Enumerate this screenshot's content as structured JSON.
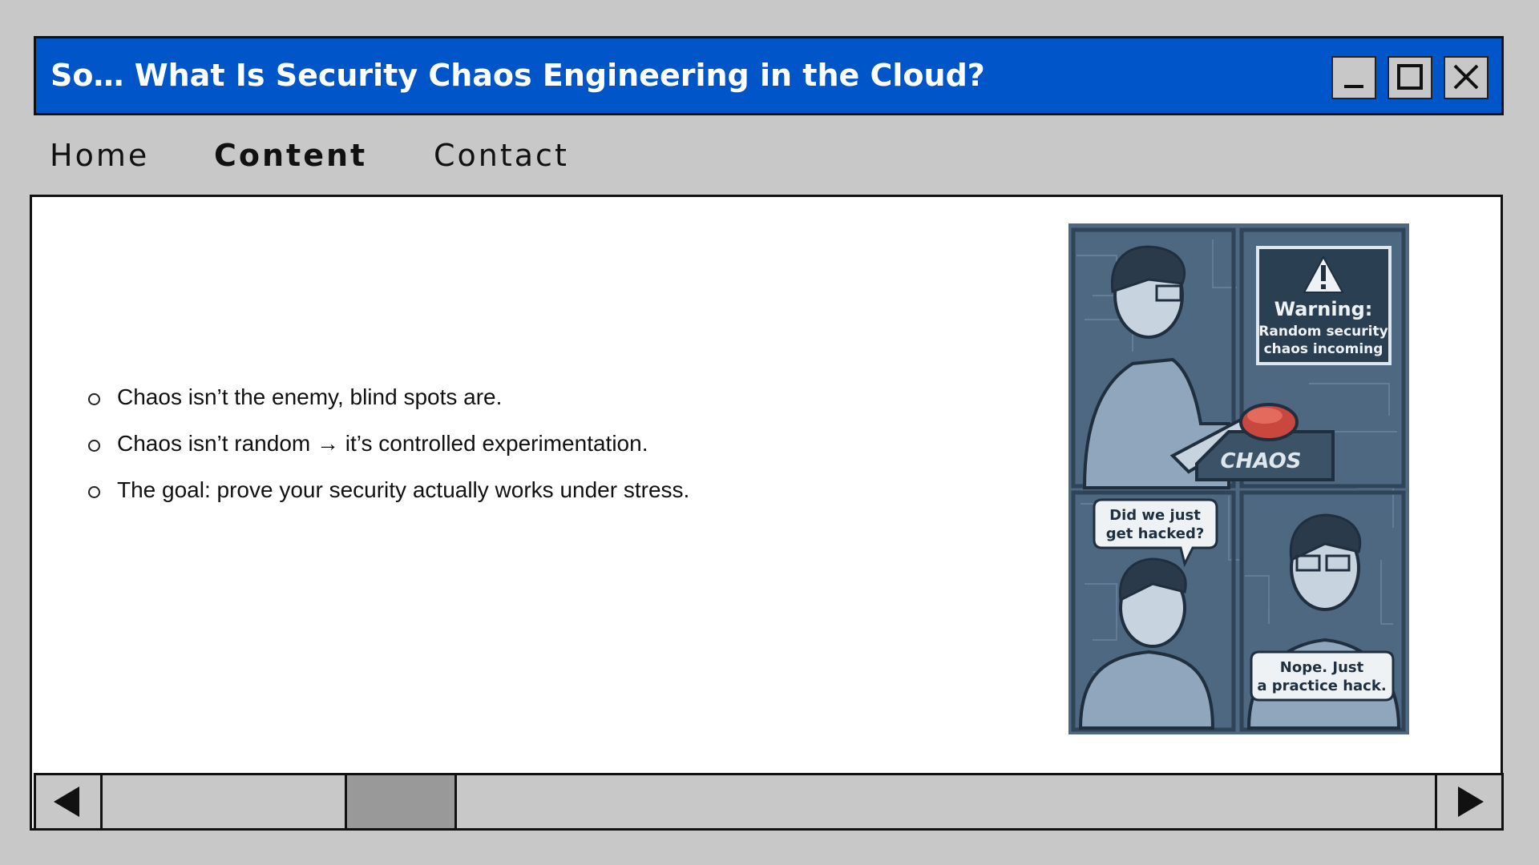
{
  "window": {
    "title": "So… What Is Security Chaos Engineering in the Cloud?",
    "buttons": [
      "minimize",
      "maximize",
      "close"
    ]
  },
  "nav": {
    "items": [
      {
        "label": "Home",
        "active": false
      },
      {
        "label": "Content",
        "active": true
      },
      {
        "label": "Contact",
        "active": false
      }
    ]
  },
  "content": {
    "bullets": [
      "Chaos isn’t the enemy, blind spots are.",
      "Chaos isn’t random → it’s controlled experimentation.",
      "The goal: prove your security actually works under stress."
    ],
    "comic": {
      "warning_title": "Warning:",
      "warning_line1": "Random security",
      "warning_line2": "chaos incoming",
      "button_label": "CHAOS",
      "bubble_left_line1": "Did we just",
      "bubble_left_line2": "get hacked?",
      "bubble_right_line1": "Nope. Just",
      "bubble_right_line2": "a practice hack."
    }
  },
  "scrollbar": {
    "left_icon": "arrow-left-icon",
    "right_icon": "arrow-right-icon"
  },
  "colors": {
    "titlebar": "#0056c8",
    "background": "#c8c8c8",
    "thumb": "#999999"
  }
}
